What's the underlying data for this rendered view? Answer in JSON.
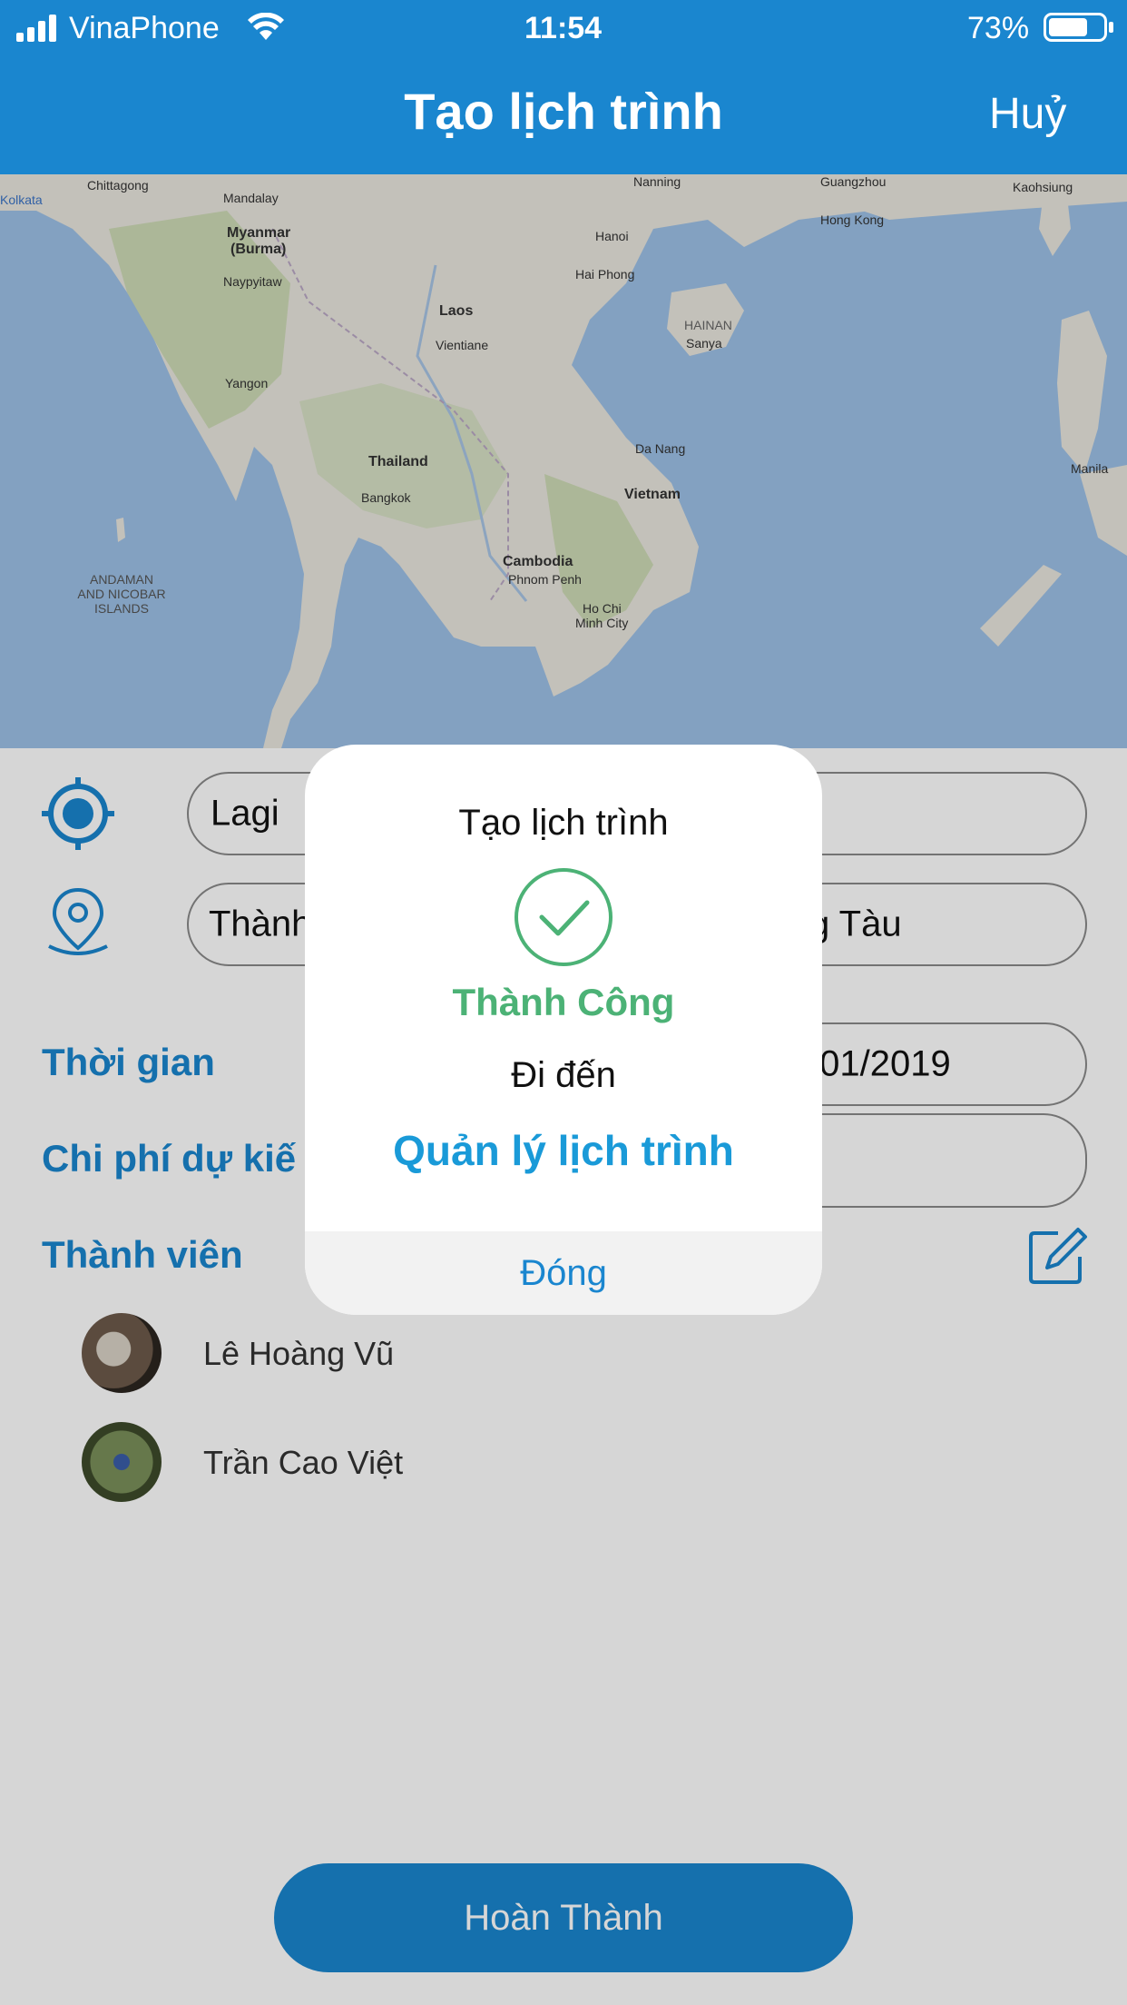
{
  "status": {
    "carrier": "VinaPhone",
    "time": "11:54",
    "battery_percent": "73%",
    "battery_level": 0.73
  },
  "nav": {
    "title": "Tạo lịch trình",
    "cancel": "Huỷ"
  },
  "map": {
    "labels": {
      "chittagong": "Chittagong",
      "mandalay": "Mandalay",
      "myanmar": "Myanmar",
      "burma": "(Burma)",
      "naypyitaw": "Naypyitaw",
      "yangon": "Yangon",
      "laos": "Laos",
      "vientiane": "Vientiane",
      "thailand": "Thailand",
      "bangkok": "Bangkok",
      "cambodia": "Cambodia",
      "phnompenh": "Phnom Penh",
      "vietnam": "Vietnam",
      "hanoi": "Hanoi",
      "haiphong": "Hai Phong",
      "hochiminh": "Ho Chi",
      "minhcity": "Minh City",
      "danang": "Da Nang",
      "nanning": "Nanning",
      "guangzhou": "Guangzhou",
      "hongkong": "Hong Kong",
      "kaohsiung": "Kaohsiung",
      "hainan": "HAINAN",
      "sanya": "Sanya",
      "manila": "Manila",
      "andaman": "ANDAMAN AND NICOBAR ISLANDS",
      "kolkata": "Kolkata"
    }
  },
  "form": {
    "origin_value": "Lagi",
    "destination_left": "Thành",
    "destination_right": "g Tàu",
    "time_label": "Thời gian",
    "date_value": "/01/2019",
    "cost_label": "Chi phí dự kiế",
    "members_label": "Thành viên",
    "members": [
      {
        "name": "Lê Hoàng Vũ"
      },
      {
        "name": "Trần Cao Việt"
      }
    ],
    "done_button": "Hoàn Thành"
  },
  "dialog": {
    "title": "Tạo lịch trình",
    "success": "Thành Công",
    "go_to": "Đi đến",
    "manage_link": "Quản lý lịch trình",
    "close": "Đóng"
  },
  "colors": {
    "primary": "#1a86cf",
    "success": "#4cb276",
    "link": "#1a9ad8"
  },
  "icons": {
    "signal": "signal-icon",
    "wifi": "wifi-icon",
    "battery": "battery-icon",
    "origin": "location-target-icon",
    "destination": "map-pin-icon",
    "edit": "edit-icon",
    "check": "check-circle-icon"
  }
}
